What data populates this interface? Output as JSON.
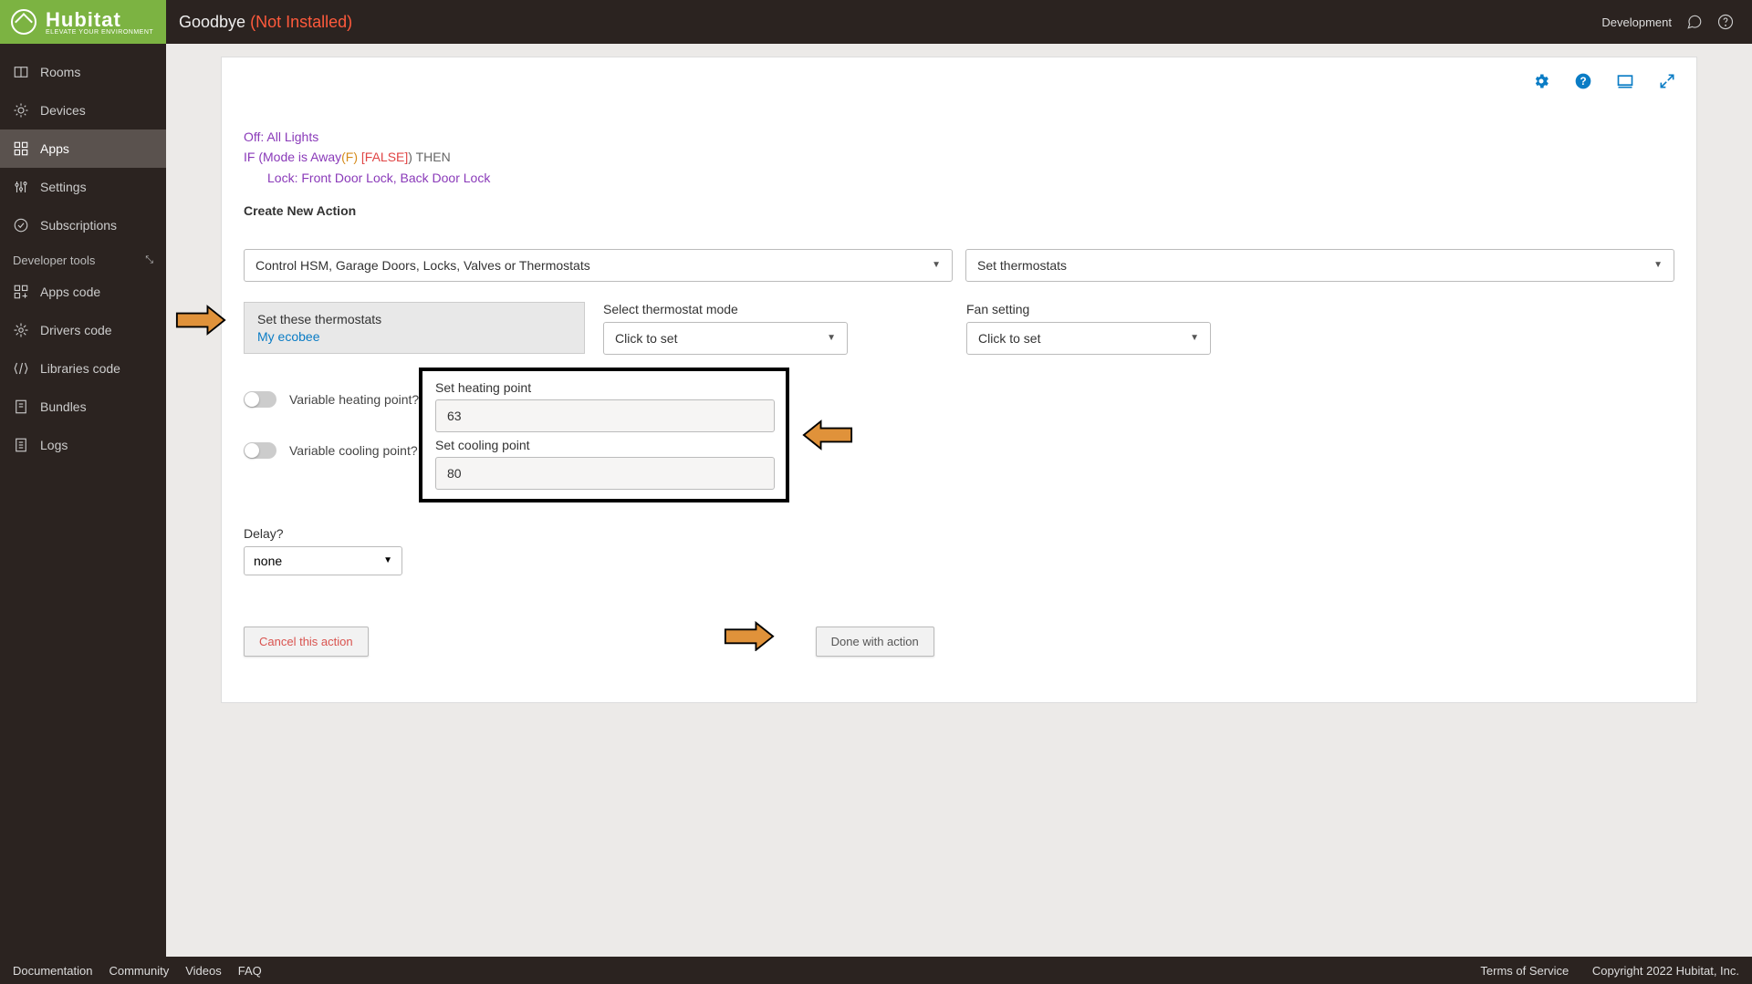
{
  "header": {
    "brand": "Hubitat",
    "tagline": "ELEVATE YOUR ENVIRONMENT",
    "title": "Goodbye",
    "status": "(Not Installed)",
    "env": "Development"
  },
  "sidebar": {
    "items": [
      {
        "label": "Rooms"
      },
      {
        "label": "Devices"
      },
      {
        "label": "Apps"
      },
      {
        "label": "Settings"
      },
      {
        "label": "Subscriptions"
      }
    ],
    "dev_header": "Developer tools",
    "dev_items": [
      {
        "label": "Apps code"
      },
      {
        "label": "Drivers code"
      },
      {
        "label": "Libraries code"
      },
      {
        "label": "Bundles"
      },
      {
        "label": "Logs"
      }
    ]
  },
  "rule": {
    "off": "Off: All Lights",
    "if": "IF (Mode is Away",
    "cond": "(F)",
    "false": " [FALSE]",
    "paren_then": ") THEN",
    "lock": "Lock: Front Door Lock, Back Door Lock",
    "create": "Create New Action"
  },
  "selects": {
    "category": "Control HSM, Garage Doors, Locks, Valves or Thermostats",
    "action": "Set thermostats"
  },
  "thermostats": {
    "label": "Set these thermostats",
    "value": "My ecobee"
  },
  "mode": {
    "label": "Select thermostat mode",
    "value": "Click to set"
  },
  "fan": {
    "label": "Fan setting",
    "value": "Click to set"
  },
  "points": {
    "heat_label": "Set heating point",
    "heat_value": "63",
    "cool_label": "Set cooling point",
    "cool_value": "80"
  },
  "toggles": {
    "heating": "Variable heating point?",
    "cooling": "Variable cooling point?"
  },
  "delay": {
    "label": "Delay?",
    "value": "none"
  },
  "buttons": {
    "cancel": "Cancel this action",
    "done": "Done with action"
  },
  "footer": {
    "links": [
      "Documentation",
      "Community",
      "Videos",
      "FAQ"
    ],
    "terms": "Terms of Service",
    "copyright": "Copyright 2022 Hubitat, Inc."
  }
}
